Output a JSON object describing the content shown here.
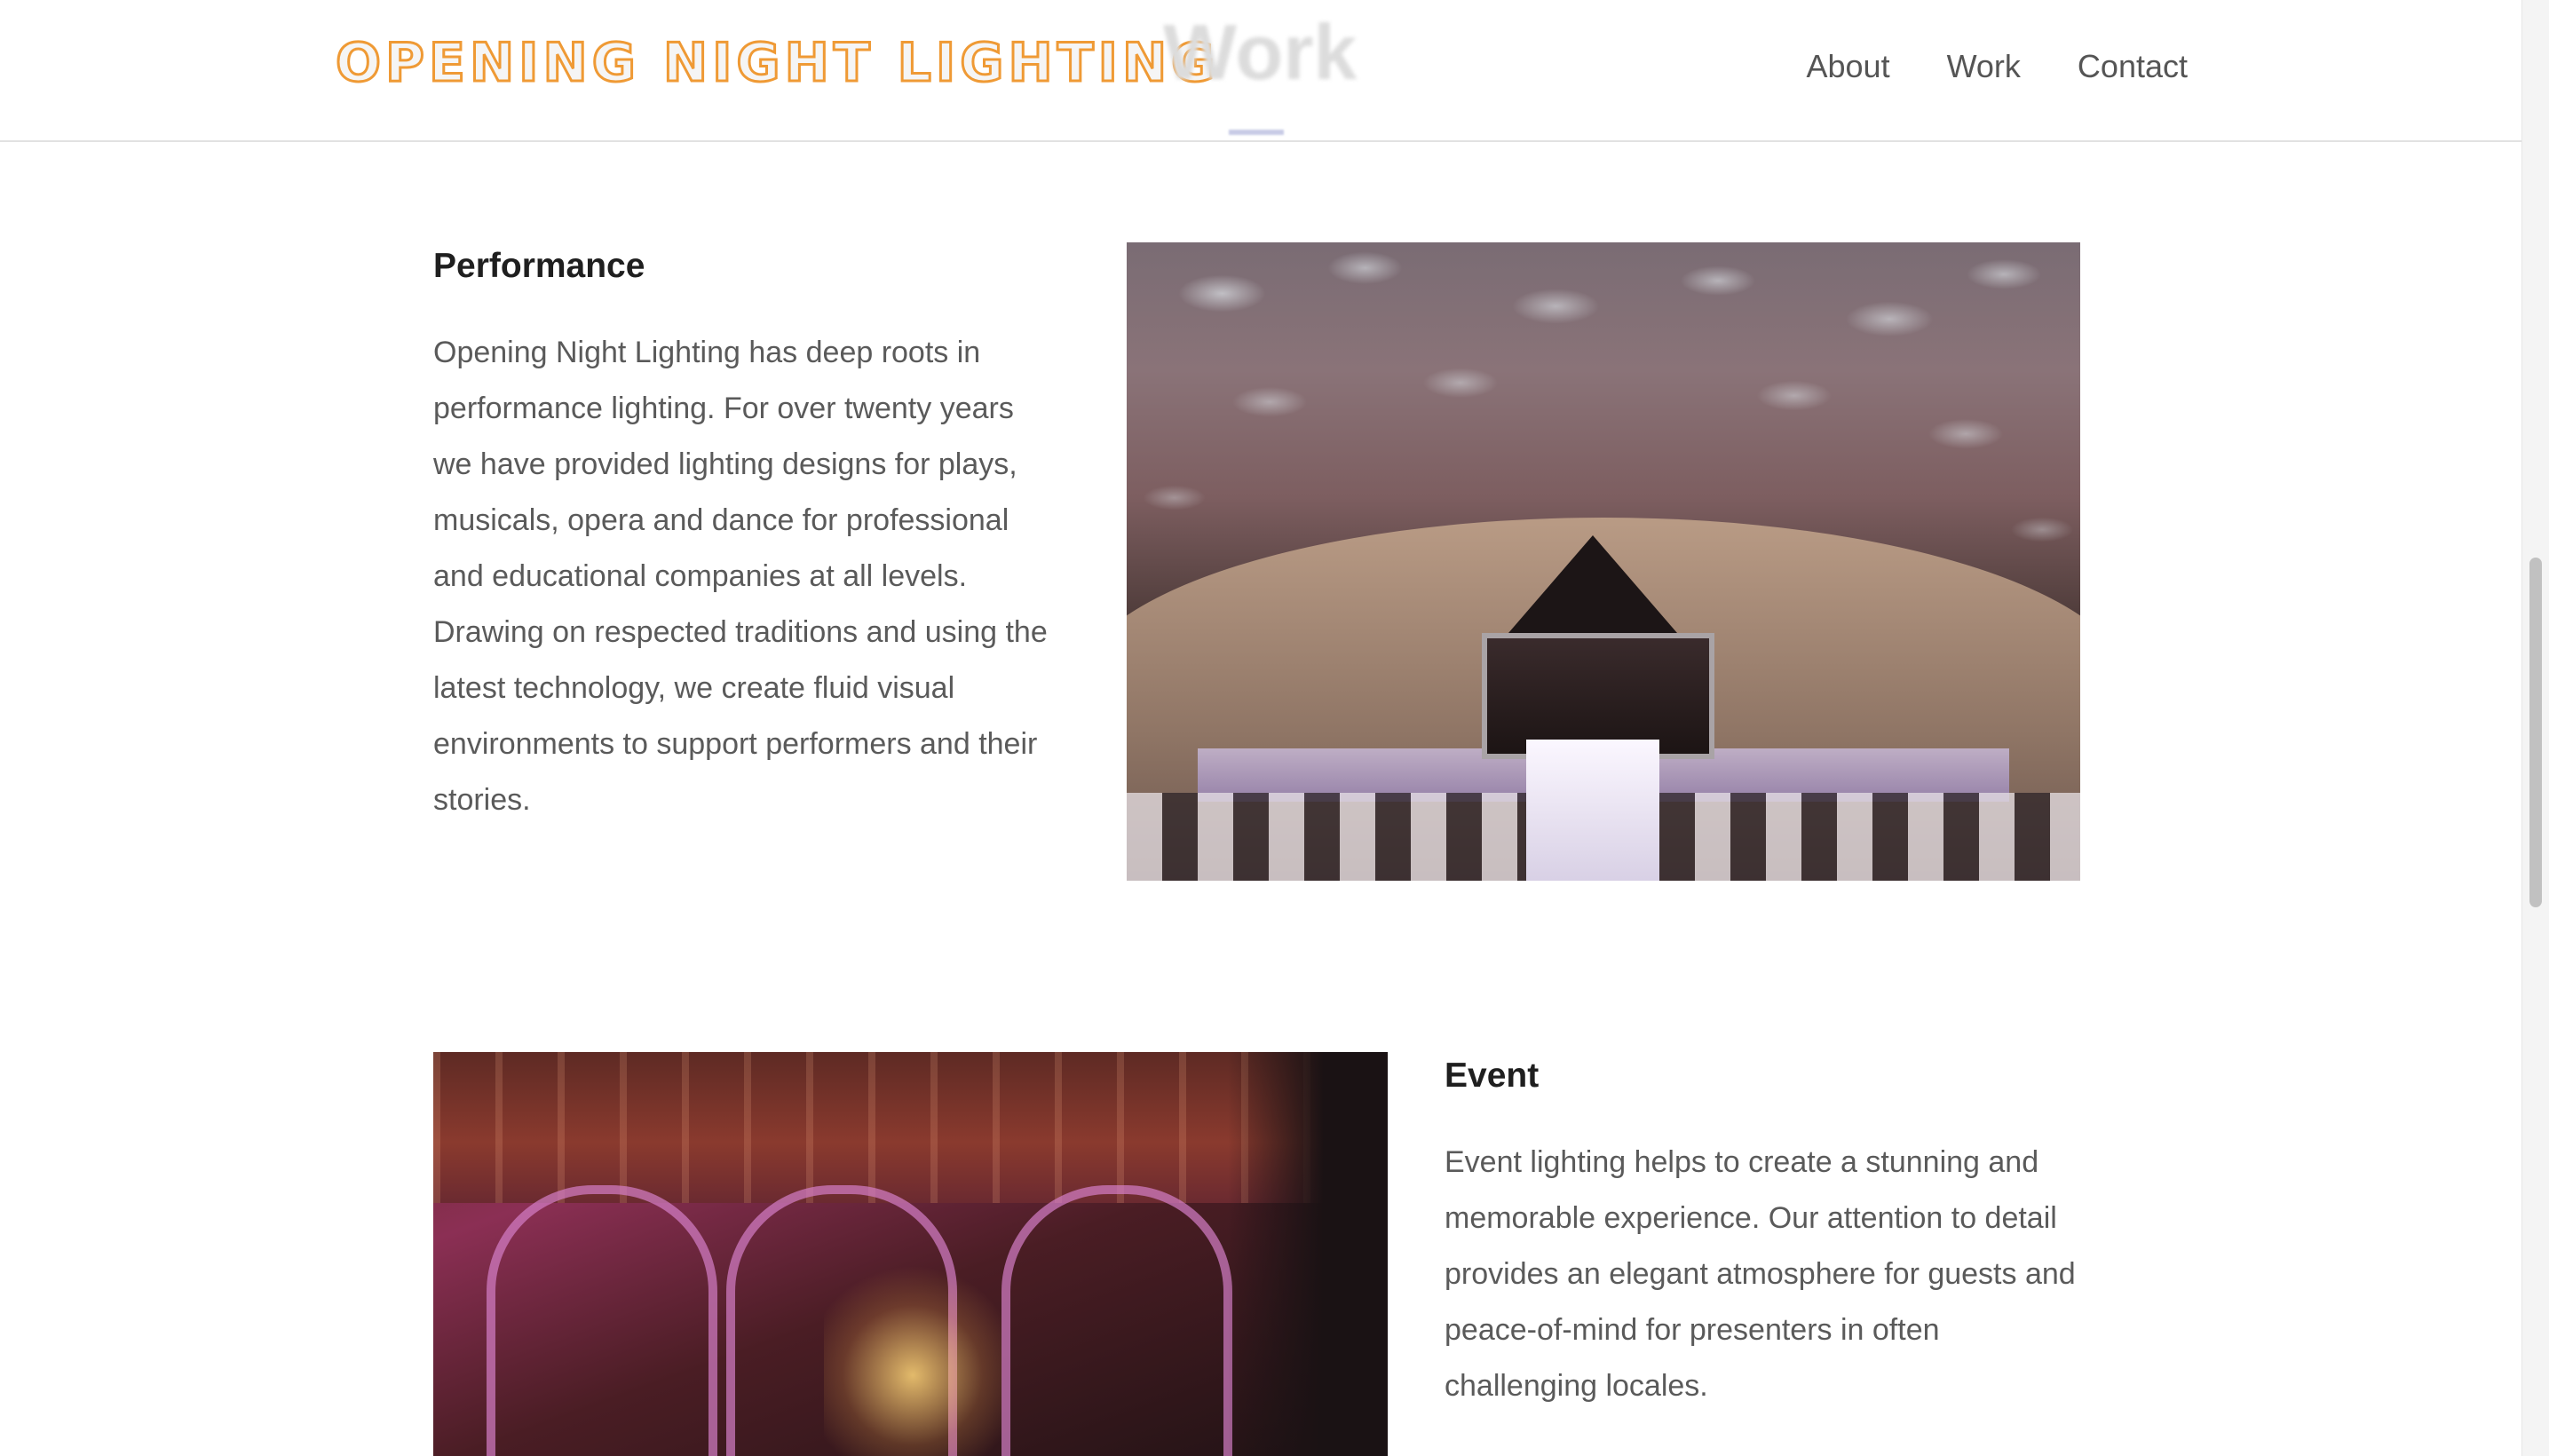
{
  "header": {
    "logo_text": "OPENING NIGHT LIGHTING",
    "faded_heading": "Work",
    "nav": [
      {
        "label": "About"
      },
      {
        "label": "Work"
      },
      {
        "label": "Contact"
      }
    ]
  },
  "sections": {
    "performance": {
      "title": "Performance",
      "text": "Opening Night Lighting has deep roots in performance lighting. For over twenty years we have provided lighting designs for plays, musicals, opera and dance for professional and educational companies at all levels. Drawing on respected traditions and using the latest technology, we create fluid visual environments to support performers and their stories."
    },
    "event": {
      "title": "Event",
      "text": "Event lighting helps to create a stunning and memorable experience. Our attention to detail provides an elegant atmosphere for guests and peace-of-mind for presenters in often challenging locales."
    }
  },
  "colors": {
    "logo_outline": "#ef9a35",
    "heading": "#1f1f1f",
    "body_text": "#5a5a5a",
    "nav_text": "#555555"
  }
}
